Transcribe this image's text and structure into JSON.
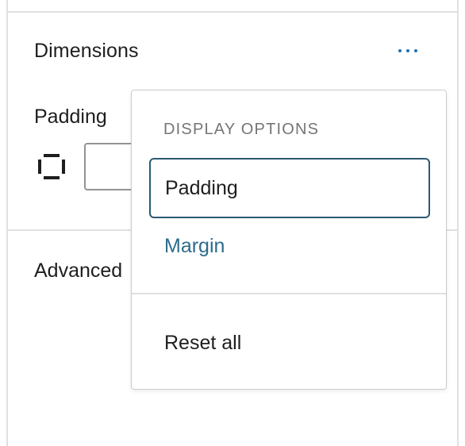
{
  "panel": {
    "title": "Dimensions",
    "options_icon": "ellipsis-icon",
    "field_label": "Padding",
    "linked_icon": "box-sides-icon",
    "next_section": "Advanced"
  },
  "menu": {
    "group_heading": "Display options",
    "items": [
      {
        "label": "Padding",
        "state": "selected"
      },
      {
        "label": "Margin",
        "state": "available"
      }
    ],
    "reset_label": "Reset all"
  },
  "colors": {
    "accent": "#2271b1",
    "selected_border": "#2c5a73",
    "link_text": "#2c6c8c",
    "muted_text": "#757575",
    "border": "#e0e0e0"
  }
}
